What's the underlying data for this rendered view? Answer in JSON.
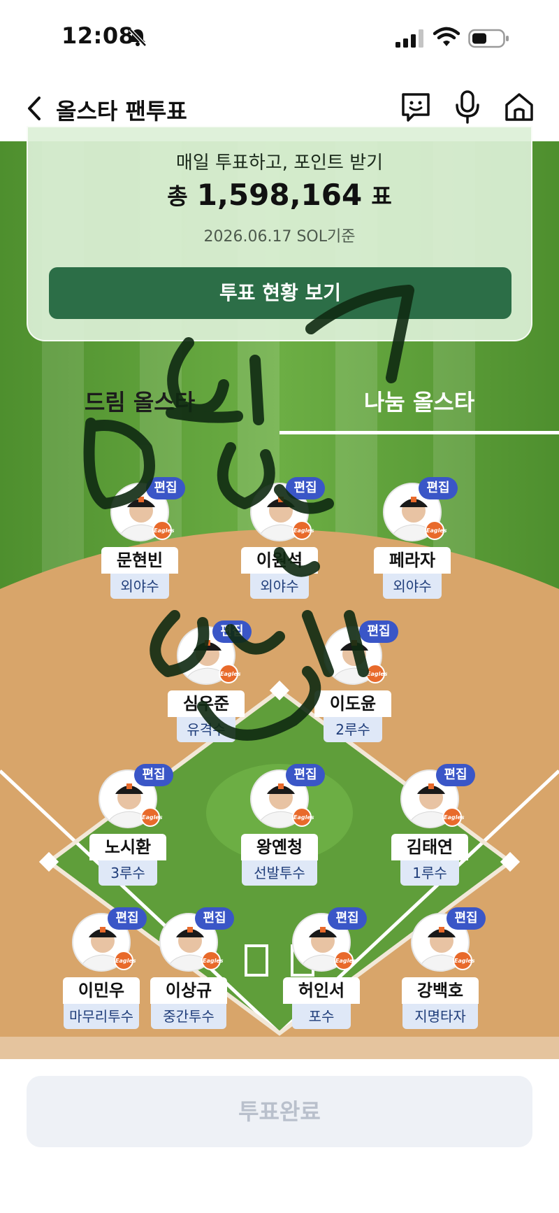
{
  "status_bar": {
    "time": "12:08",
    "icons": [
      "bell-slash-icon",
      "cellular-signal-icon",
      "wifi-icon",
      "battery-icon"
    ]
  },
  "nav": {
    "title": "올스타 팬투표",
    "icons": [
      "back-icon",
      "chat-icon",
      "mic-icon",
      "home-icon"
    ]
  },
  "card": {
    "subtitle": "매일 투표하고, 포인트 받기",
    "total_prefix": "총",
    "total_value": "1,598,164",
    "total_suffix": "표",
    "date": "2026.06.17 SOL기준",
    "status_button": "투표 현황 보기"
  },
  "tabs": [
    {
      "label": "드림 올스타",
      "active": false
    },
    {
      "label": "나눔 올스타",
      "active": true
    }
  ],
  "edit_label": "편집",
  "team_logo_text": "Eagles",
  "players": [
    {
      "name": "문현빈",
      "position": "외야수"
    },
    {
      "name": "이원석",
      "position": "외야수"
    },
    {
      "name": "페라자",
      "position": "외야수"
    },
    {
      "name": "심우준",
      "position": "유격수"
    },
    {
      "name": "이도윤",
      "position": "2루수"
    },
    {
      "name": "노시환",
      "position": "3루수"
    },
    {
      "name": "왕옌청",
      "position": "선발투수"
    },
    {
      "name": "김태연",
      "position": "1루수"
    },
    {
      "name": "이민우",
      "position": "마무리투수"
    },
    {
      "name": "이상규",
      "position": "중간투수"
    },
    {
      "name": "허인서",
      "position": "포수"
    },
    {
      "name": "강백호",
      "position": "지명타자"
    }
  ],
  "bottom": {
    "complete_button": "투표완료"
  },
  "colors": {
    "grass": "#5f9e3a",
    "dirt": "#d8a56a",
    "vote_button": "#2c6e47",
    "edit_badge": "#3a56c7",
    "position_bg": "#dfe8f7"
  }
}
